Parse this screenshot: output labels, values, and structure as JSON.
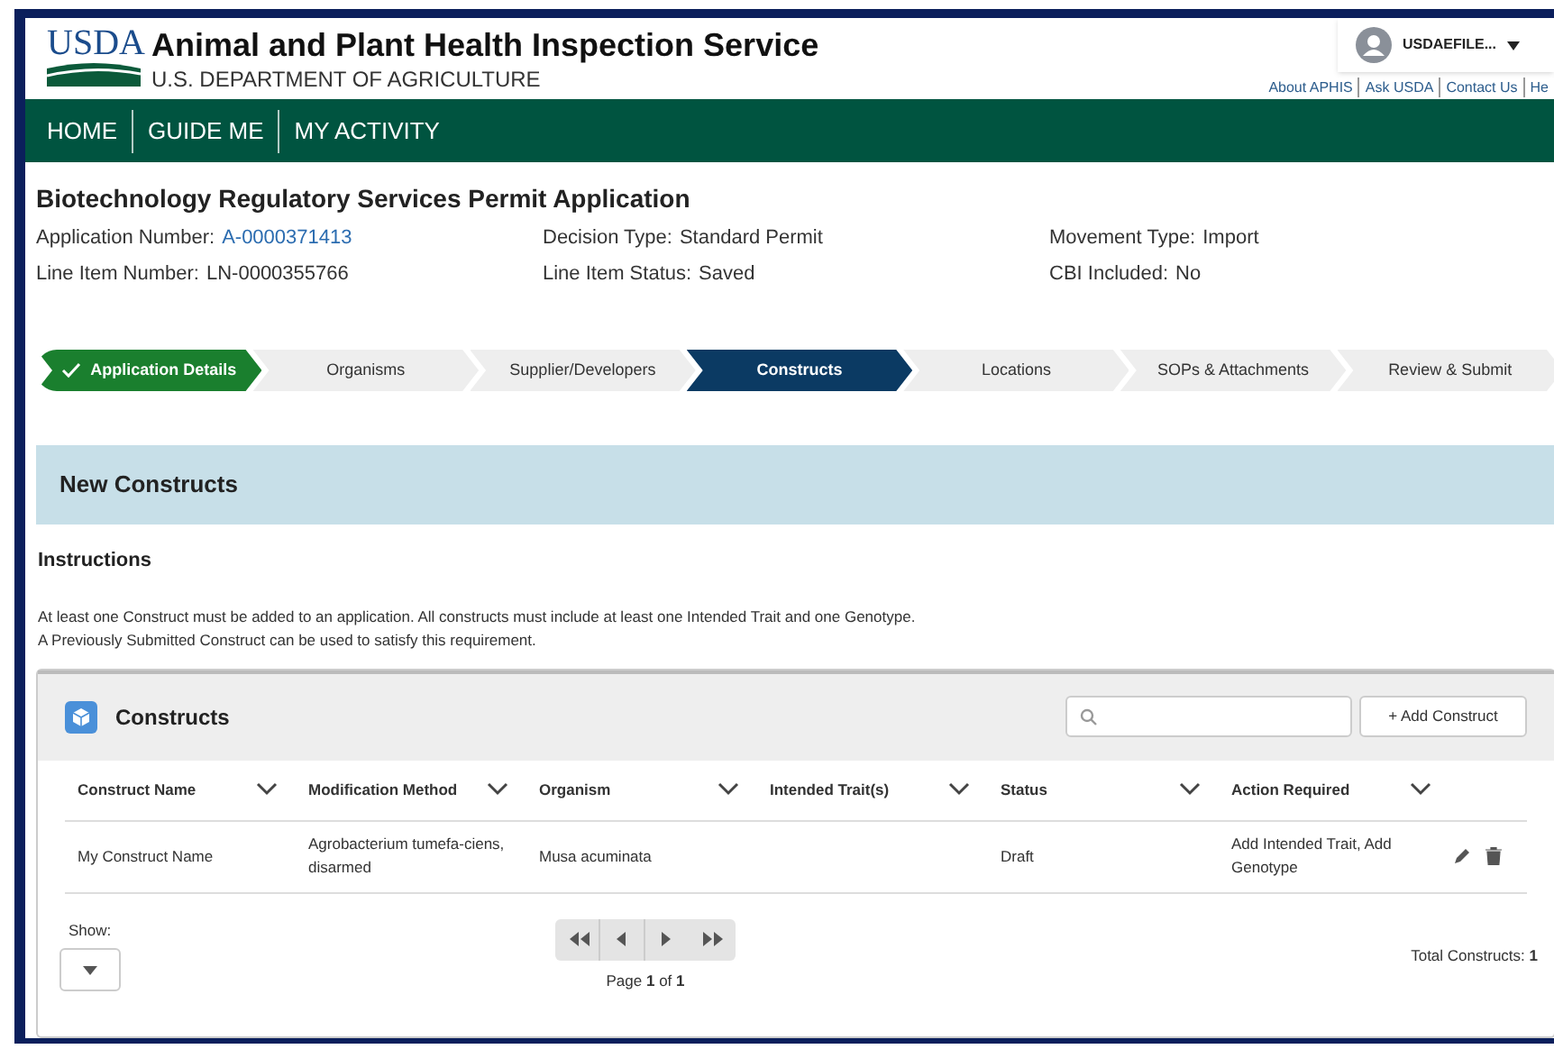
{
  "header": {
    "logo": "USDA",
    "agency": "Animal and Plant Health Inspection Service",
    "department": "U.S. DEPARTMENT OF AGRICULTURE",
    "user": "USDAEFILE...",
    "links": [
      "About APHIS",
      "Ask USDA",
      "Contact Us",
      "He"
    ]
  },
  "nav": [
    "HOME",
    "GUIDE ME",
    "MY ACTIVITY"
  ],
  "application": {
    "title": "Biotechnology Regulatory Services Permit Application",
    "fields": [
      {
        "label": "Application Number:",
        "value": "A-0000371413",
        "kind": "link"
      },
      {
        "label": "Decision Type:",
        "value": "Standard Permit",
        "kind": "text"
      },
      {
        "label": "Movement Type:",
        "value": "Import",
        "kind": "text"
      },
      {
        "label": "Line Item Number:",
        "value": "LN-0000355766",
        "kind": "text"
      },
      {
        "label": "Line Item Status:",
        "value": "Saved",
        "kind": "text"
      },
      {
        "label": "CBI Included:",
        "value": "No",
        "kind": "text"
      }
    ]
  },
  "steps": [
    {
      "label": "Application Details",
      "completed": true,
      "selected": false
    },
    {
      "label": "Organisms",
      "completed": false,
      "selected": false
    },
    {
      "label": "Supplier/Developers",
      "completed": false,
      "selected": false
    },
    {
      "label": "Constructs",
      "completed": false,
      "selected": true
    },
    {
      "label": "Locations",
      "completed": false,
      "selected": false
    },
    {
      "label": "SOPs & Attachments",
      "completed": false,
      "selected": false
    },
    {
      "label": "Review & Submit",
      "completed": false,
      "selected": false
    }
  ],
  "banner": "New Constructs",
  "instructions": {
    "heading": "Instructions",
    "lines": [
      "At least one Construct must be added to an application. All constructs must include at least one Intended Trait and one Genotype.",
      "A Previously Submitted Construct can be used to satisfy this requirement."
    ]
  },
  "card": {
    "title": "Constructs",
    "add_button": "+ Add Construct",
    "table": {
      "columns": [
        "Construct Name",
        "Modification Method",
        "Organism",
        "Intended Trait(s)",
        "Status",
        "Action Required"
      ],
      "rows": [
        [
          "My Construct Name",
          "Agrobacterium tumefa-ciens, disarmed",
          "Musa acuminata",
          "",
          "Draft",
          "Add Intended Trait, Add Genotype"
        ]
      ]
    },
    "show_label": "Show:",
    "page": "Page **1** of **1**",
    "total": "Total Constructs: **1**"
  }
}
